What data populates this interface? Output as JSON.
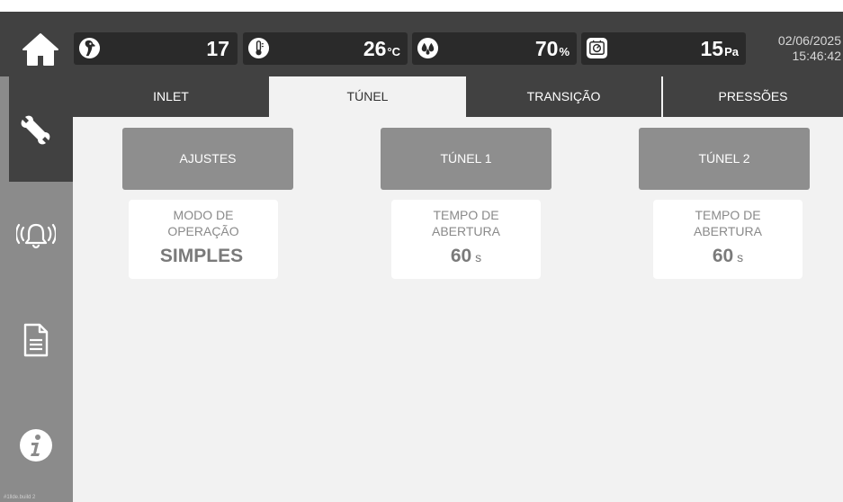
{
  "status_bar": {
    "home_icon": "home-icon",
    "birds": {
      "icon": "bird-head-icon",
      "value": "17",
      "unit": ""
    },
    "temperature": {
      "icon": "thermometer-icon",
      "value": "26",
      "unit": "°C"
    },
    "humidity": {
      "icon": "water-drops-icon",
      "value": "70",
      "unit": "%"
    },
    "pressure": {
      "icon": "pressure-gauge-icon",
      "value": "15",
      "unit": "Pa"
    },
    "date": "02/06/2025",
    "time": "15:46:42"
  },
  "sidebar": {
    "items": [
      {
        "name": "settings",
        "icon": "wrench-icon",
        "active": true
      },
      {
        "name": "alarms",
        "icon": "alarm-bell-icon",
        "active": false
      },
      {
        "name": "reports",
        "icon": "document-icon",
        "active": false
      },
      {
        "name": "info",
        "icon": "info-icon",
        "active": false
      }
    ],
    "footer_text": "#1llde.build 2"
  },
  "tabs": [
    {
      "label": "INLET",
      "active": false
    },
    {
      "label": "TÚNEL",
      "active": true
    },
    {
      "label": "TRANSIÇÃO",
      "active": false
    },
    {
      "label": "PRESSÕES",
      "active": false
    }
  ],
  "sections": [
    {
      "button_label": "AJUSTES",
      "card": {
        "title_line1": "MODO DE",
        "title_line2": "OPERAÇÃO",
        "value": "SIMPLES",
        "unit": ""
      }
    },
    {
      "button_label": "TÚNEL 1",
      "card": {
        "title_line1": "TEMPO DE",
        "title_line2": "ABERTURA",
        "value": "60",
        "unit": "s"
      }
    },
    {
      "button_label": "TÚNEL 2",
      "card": {
        "title_line1": "TEMPO DE",
        "title_line2": "ABERTURA",
        "value": "60",
        "unit": "s"
      }
    }
  ],
  "colors": {
    "topbar": "#414141",
    "stat_box": "#2a2a2a",
    "sidebar": "#8b8b8b",
    "panel": "#f2f2f2",
    "section_button": "#8e8e8e"
  }
}
